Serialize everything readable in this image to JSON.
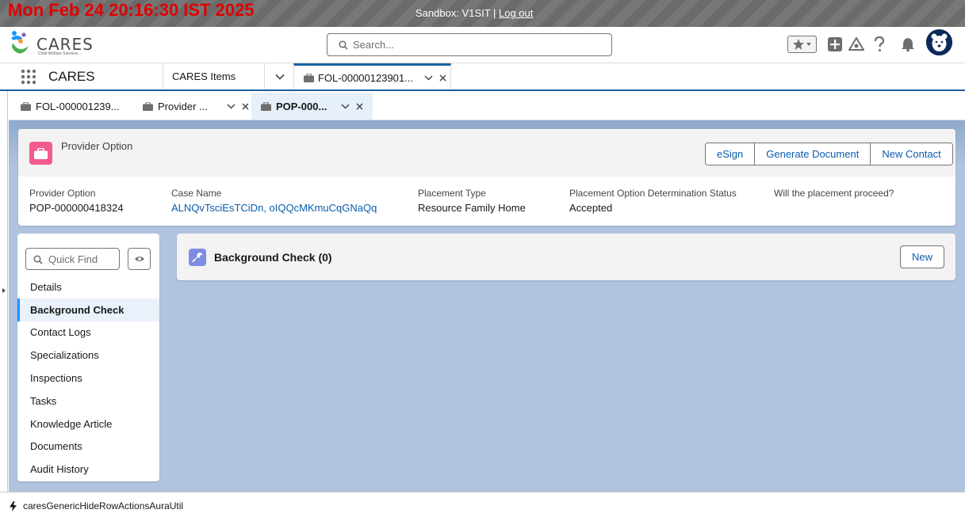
{
  "sandbox_bar": {
    "clock": "Mon Feb 24 20:16:30 IST 2025",
    "sandbox_label": "Sandbox: V1SIT |",
    "logout_label": "Log out"
  },
  "global_header": {
    "logo_text": "CARES",
    "logo_subtitle": "Child Welfare Services",
    "search_placeholder": "Search...",
    "icons": [
      "favorites-star-icon",
      "global-add-icon",
      "trailhead-icon",
      "help-icon",
      "notifications-bell-icon",
      "user-avatar"
    ]
  },
  "app_nav": {
    "app_name": "CARES",
    "items_tab_label": "CARES Items",
    "active_tab_label": "FOL-00000123901..."
  },
  "subtabs": [
    {
      "label": "FOL-000001239...",
      "closable": false
    },
    {
      "label": "Provider ...",
      "closable": true
    },
    {
      "label": "POP-000...",
      "closable": true,
      "active": true
    }
  ],
  "record": {
    "type_label": "Provider Option",
    "actions": [
      "eSign",
      "Generate Document",
      "New Contact"
    ],
    "highlights": [
      {
        "label": "Provider Option",
        "value": "POP-000000418324",
        "link": false
      },
      {
        "label": "Case Name",
        "value": "ALNQvTsciEsTCiDn, oIQQcMKmuCqGNaQq",
        "link": true
      },
      {
        "label": "Placement Type",
        "value": "Resource Family Home",
        "link": false
      },
      {
        "label": "Placement Option Determination Status",
        "value": "Accepted",
        "link": false
      },
      {
        "label": "Will the placement proceed?",
        "value": "",
        "link": false
      }
    ]
  },
  "related_nav": {
    "quick_find_placeholder": "Quick Find",
    "items": [
      "Details",
      "Background Check",
      "Contact Logs",
      "Specializations",
      "Inspections",
      "Tasks",
      "Knowledge Article",
      "Documents",
      "Audit History"
    ],
    "active_index": 1
  },
  "related_list": {
    "title": "Background Check (0)",
    "new_label": "New"
  },
  "utility_bar": {
    "item_label": "caresGenericHideRowActionsAuraUtil"
  },
  "colors": {
    "brand_blue": "#0b5cab",
    "record_icon": "#f25b8b",
    "related_icon": "#7f8de1",
    "workspace_bg": "#b0c4df",
    "clock_red": "#e00000"
  }
}
